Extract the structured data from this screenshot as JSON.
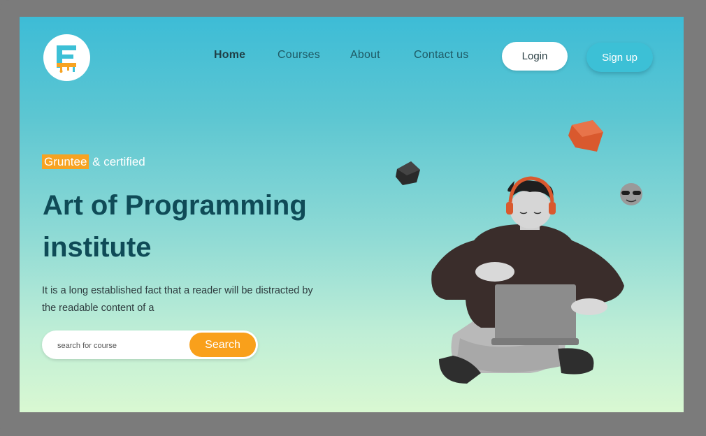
{
  "brand": {
    "logo_icon": "logo-e-drip-icon",
    "logo_color": "#3cc0d6",
    "logo_accent": "#f7a322"
  },
  "nav": {
    "items": [
      {
        "label": "Home",
        "active": true
      },
      {
        "label": "Courses",
        "active": false
      },
      {
        "label": "About",
        "active": false
      },
      {
        "label": "Contact us",
        "active": false
      }
    ],
    "login_label": "Login",
    "signup_label": "Sign up"
  },
  "hero": {
    "tag_highlight": "Gruntee",
    "tag_rest": " & certified",
    "title_line1": "Art of Programming",
    "title_line2": "institute",
    "description": "It is a long established fact that a reader will be distracted by the readable content of a",
    "search_placeholder": "search for course",
    "search_button": "Search"
  },
  "colors": {
    "accent": "#f9a01b",
    "brand": "#3cc0d6",
    "heading": "#0f4b57"
  }
}
